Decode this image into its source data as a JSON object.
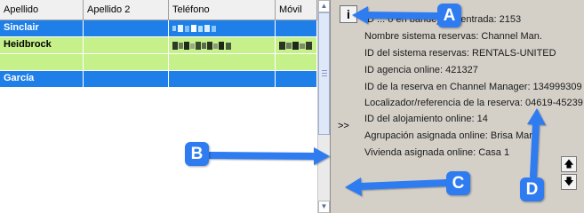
{
  "table": {
    "columns": [
      "Apellido",
      "Apellido 2",
      "Teléfono",
      "Móvil"
    ],
    "rows": [
      {
        "apellido": "Sinclair",
        "style": "blue"
      },
      {
        "apellido": "Heidbrock",
        "style": "green"
      },
      {
        "apellido": "",
        "style": "green"
      },
      {
        "apellido": "García",
        "style": "blue"
      }
    ]
  },
  "scrollbar": {
    "up": "▲",
    "down": "▼"
  },
  "info": {
    "button": "i",
    "collapse": ">>",
    "line1": "ID ... o en bandeja de entrada: 2153",
    "line2": "Nombre sistema reservas: Channel Man.",
    "line3": "ID del sistema reservas: RENTALS-UNITED",
    "line4": "ID agencia online: 421327",
    "line5": "ID de la reserva en Channel Manager: 134999309",
    "line6": "Localizador/referencia de la reserva: 04619-45239",
    "line7": "ID del alojamiento online: 14",
    "line8": "Agrupación asignada online: Brisa Mar",
    "line9": "Vivienda asignada online: Casa 1",
    "up": "🡅",
    "down": "🡇"
  },
  "callouts": {
    "a": "A",
    "b": "B",
    "c": "C",
    "d": "D"
  },
  "colors": {
    "blue_row": "#1e7fe8",
    "green_row": "#c6f08a",
    "callout": "#2f7bf0"
  }
}
